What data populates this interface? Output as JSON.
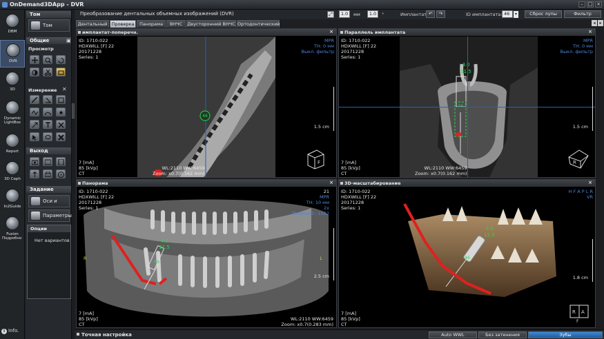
{
  "window": {
    "title": "OnDemand3DApp - DVR"
  },
  "rail": {
    "items": [
      {
        "label": "DBM"
      },
      {
        "label": "DVR"
      },
      {
        "label": "3D"
      },
      {
        "label": "Dynamic LightBox"
      },
      {
        "label": "Report"
      },
      {
        "label": "3D Ceph"
      },
      {
        "label": "In2Guide"
      },
      {
        "label": "Fusion"
      }
    ],
    "more": "Подробно",
    "info": "Info."
  },
  "tools": {
    "volume_header": "Том",
    "volume_button": "Том",
    "general_header": "Общие",
    "view_sub": "Просмотр",
    "measure_sub": "Измерение",
    "output_header": "Выход",
    "task_header": "Задание",
    "axes_button": "Оси и срезы",
    "params_button": "Параметры",
    "options_header": "Опции",
    "options_text": "Нет вариантов"
  },
  "header": {
    "title": "Преобразование дентальных объемных изображений (DVR)",
    "thickness_value": "1.0",
    "thickness_unit": "мм",
    "angle_value": "1.0",
    "angle_unit": "°",
    "implant_label": "Имплантат:",
    "implant_id_label": "ID имплантата:",
    "implant_id_value": "46",
    "reset_zoom": "Сброс лупы",
    "filter": "Фильтр"
  },
  "tabs": [
    {
      "label": "Дентальный",
      "active": false
    },
    {
      "label": "Проверка",
      "active": true
    },
    {
      "label": "Панорама",
      "active": false
    },
    {
      "label": "ВНЧС",
      "active": false
    },
    {
      "label": "Двусторонний ВНЧС",
      "active": false
    },
    {
      "label": "Ортодонтический",
      "active": false
    }
  ],
  "views": {
    "tl": {
      "title": "имплантат-поперечн.",
      "info": [
        "ID: 1710-022",
        "HDXWILL [F] 22",
        "20171228",
        "Series: 1"
      ],
      "right": [
        "MPR",
        "TH: 0 мм",
        "Выкл. фильтр"
      ],
      "scale": "1.5 cm",
      "bottom_left": [
        "7 [mA]",
        "85 [kVp]",
        "CT"
      ],
      "bottom_mid": [
        "WL:2110 WW:6459",
        "Zoom: x0.7(0.162 mm)"
      ],
      "implant_id": "46",
      "cube": "F"
    },
    "tr": {
      "title": "Параллель имплантата",
      "info": [
        "ID: 1710-022",
        "HDXWILL [F] 22",
        "20171228",
        "Series: 1"
      ],
      "right": [
        "MPR",
        "TH: 0 мм",
        "Выкл. фильтр"
      ],
      "scale": "1.5 cm",
      "bottom_left": [
        "7 [mA]",
        "85 [kVp]",
        "CT"
      ],
      "bottom_mid": [
        "WL:2110 WW:6459",
        "Zoom: x0.7(0.162 mm)"
      ],
      "implant_d": "4.0",
      "implant_l": "11.5",
      "implant_id": "46",
      "cube": "R"
    },
    "bl": {
      "title": "Панорама",
      "info": [
        "ID: 1710-022",
        "HDXWILL [F] 22",
        "20171228",
        "Series: 1"
      ],
      "right_top": "21",
      "right": [
        "MPR",
        "TH: 10 мм",
        "2x",
        "Threshold : 1052"
      ],
      "side_r": "R",
      "side_l": "L",
      "scale": "2.5 cm",
      "bottom_left": [
        "7 [mA]",
        "85 [kVp]",
        "CT"
      ],
      "bottom_mid": [
        "WL:2110 WW:6459",
        "Zoom: x0.7(0.283 mm)"
      ],
      "implant_d": "4.0",
      "implant_l": "11.5",
      "implant_id": "46"
    },
    "br": {
      "title": "3D-масштабирование",
      "info": [
        "ID: 1710-022",
        "HDXWILL [F] 22",
        "20171228",
        "Series: 1"
      ],
      "right": [
        "H F A P L R",
        "VR"
      ],
      "scale": "1.8 cm",
      "bottom_left": [
        "7 [mA]",
        "85 [kVp]",
        "CT"
      ],
      "implant_d": "4.0",
      "implant_l": "11.5",
      "implant_id": "46",
      "cube_r": "R",
      "cube_a": "A",
      "cube_f": "F"
    }
  },
  "bottom": {
    "title": "Точная настройка",
    "auto_wwl": "Auto WWL",
    "no_shading": "Без затенения",
    "teeth": "Зубы"
  },
  "colors": {
    "accent": "#3f89d6",
    "overlay_blue": "#4f86d8",
    "implant_green": "#27d84a",
    "nerve_red": "#e02020"
  }
}
